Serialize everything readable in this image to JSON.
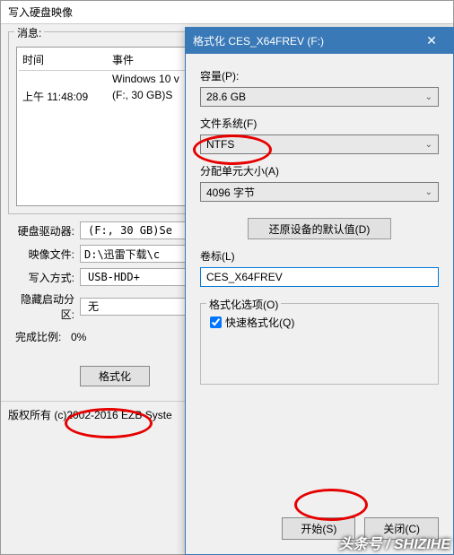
{
  "back": {
    "title": "写入硬盘映像",
    "groupbox_legend": "消息:",
    "log_headers": {
      "time": "时间",
      "event": "事件"
    },
    "log_rows": [
      {
        "time": "",
        "event": "Windows 10 v"
      },
      {
        "time": "上午 11:48:09",
        "event": "(F:, 30 GB)S"
      }
    ],
    "fields": {
      "drive_label": "硬盘驱动器:",
      "drive_value": "(F:, 30 GB)Se",
      "image_label": "映像文件:",
      "image_value": "D:\\迅雷下载\\c",
      "method_label": "写入方式:",
      "method_value": "USB-HDD+",
      "hidden_label": "隐藏启动分区:",
      "hidden_value": "无"
    },
    "progress_label": "完成比例:",
    "progress_pct": "0%",
    "format_btn": "格式化",
    "copyright": "版权所有 (c)2002-2016 EZB Syste"
  },
  "modal": {
    "title": "格式化 CES_X64FREV (F:)",
    "capacity_label": "容量(P):",
    "capacity_value": "28.6 GB",
    "fs_label": "文件系统(F)",
    "fs_value": "NTFS",
    "alloc_label": "分配单元大小(A)",
    "alloc_value": "4096 字节",
    "restore_btn": "还原设备的默认值(D)",
    "volume_label": "卷标(L)",
    "volume_value": "CES_X64FREV",
    "options_legend": "格式化选项(O)",
    "quick_format": "快速格式化(Q)",
    "start_btn": "开始(S)",
    "close_btn": "关闭(C)"
  },
  "watermark": "头条号 / SHIZIHE"
}
